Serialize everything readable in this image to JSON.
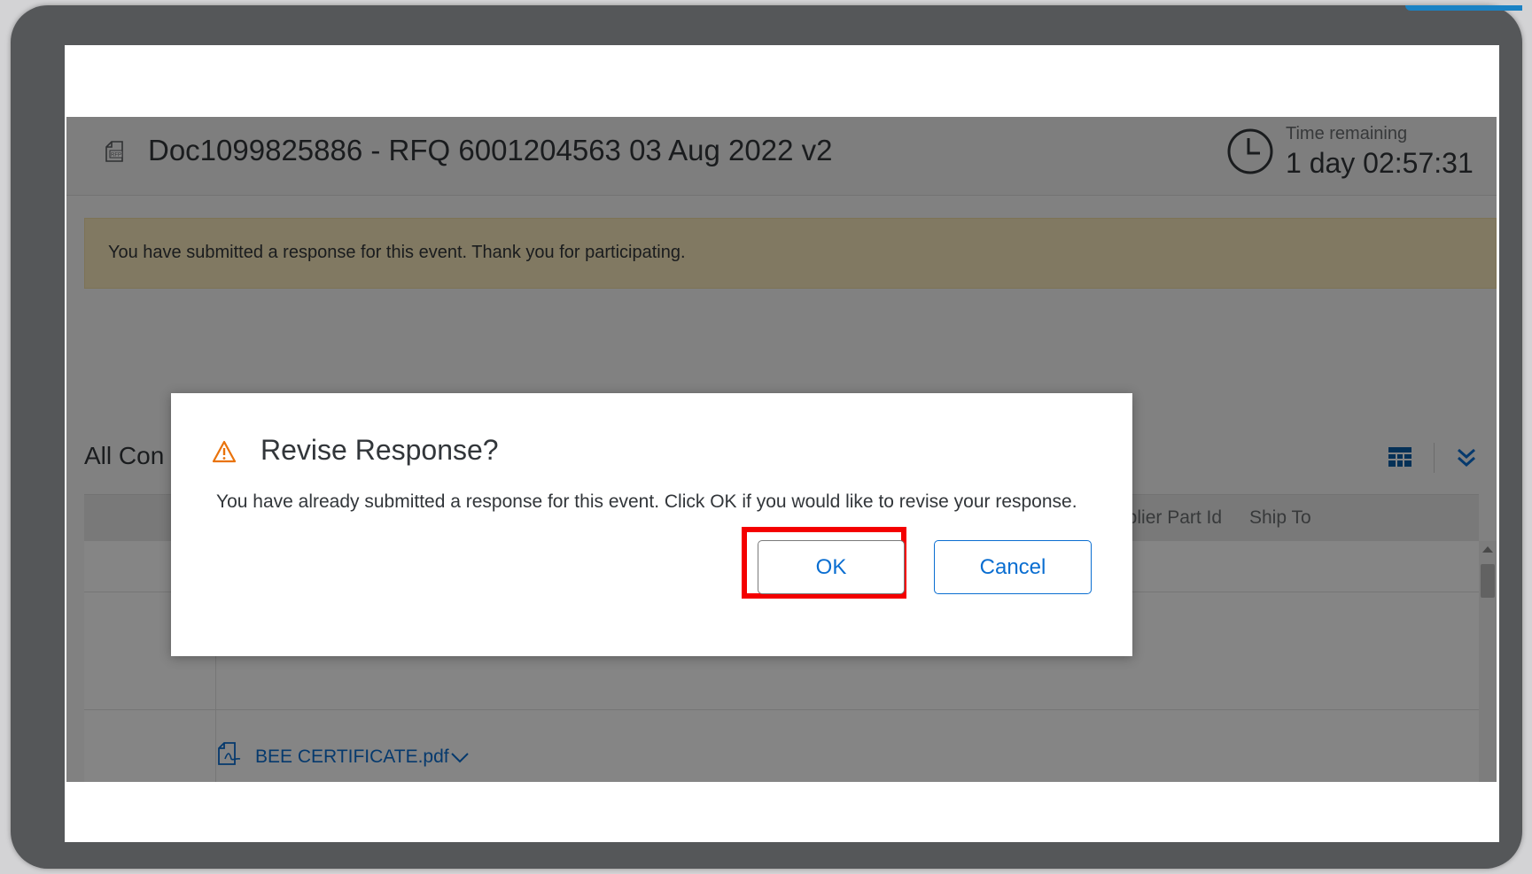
{
  "header": {
    "document_title": "Doc1099825886 - RFQ 6001204563 03 Aug 2022 v2",
    "time_remaining_label": "Time remaining",
    "time_remaining_value": "1 day 02:57:31"
  },
  "banner": {
    "message": "You have submitted a response for this event.  Thank you for participating."
  },
  "section": {
    "title": "All Con",
    "columns": [
      "pplier Part Id",
      "Ship To"
    ]
  },
  "attachment": {
    "filename": "BEE CERTIFICATE.pdf"
  },
  "dialog": {
    "title": "Revise Response?",
    "message": "You have already submitted a response for this event. Click OK if you would like to revise your response.",
    "ok_label": "OK",
    "cancel_label": "Cancel"
  },
  "icons": {
    "document": "rfp-document-icon",
    "clock": "clock-icon",
    "warning": "warning-icon",
    "table_settings": "table-settings-icon",
    "expand": "double-chevron-down-icon",
    "pdf": "pdf-file-icon",
    "chevron": "chevron-down-icon"
  },
  "colors": {
    "accent": "#0a6ed1",
    "highlight": "#f40000",
    "warning": "#e9730c",
    "banner": "#f8e9bc"
  }
}
